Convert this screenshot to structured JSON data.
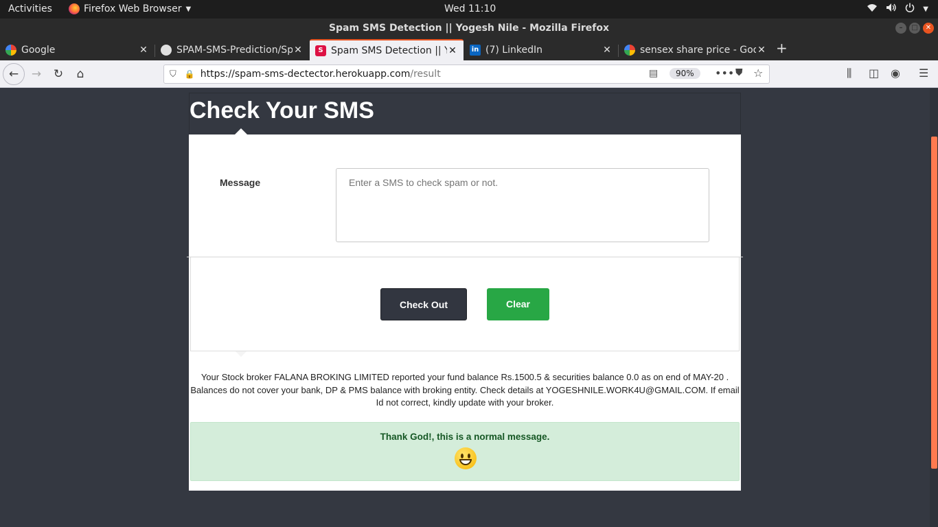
{
  "os": {
    "activities": "Activities",
    "app_menu": "Firefox Web Browser",
    "clock": "Wed 11:10"
  },
  "window": {
    "title": "Spam SMS Detection || Yogesh Nile - Mozilla Firefox"
  },
  "tabs": [
    {
      "label": "Google",
      "favicon": "google-icon"
    },
    {
      "label": "SPAM-SMS-Prediction/Sp",
      "favicon": "github-icon"
    },
    {
      "label": "Spam SMS Detection || Yo",
      "favicon": "spam-site-icon",
      "active": true
    },
    {
      "label": "(7) LinkedIn",
      "favicon": "linkedin-icon"
    },
    {
      "label": "sensex share price - Goo",
      "favicon": "google-icon"
    }
  ],
  "navbar": {
    "url_host": "https://spam-sms-dectector.herokuapp.com",
    "url_path": "/result",
    "zoom": "90%"
  },
  "page": {
    "heading": "Check Your SMS",
    "message_label": "Message",
    "message_placeholder": "Enter a SMS to check spam or not.",
    "check_button": "Check Out",
    "clear_button": "Clear",
    "sms_text": "Your Stock broker FALANA BROKING LIMITED reported your fund balance Rs.1500.5 & securities balance 0.0 as on end of MAY-20 . Balances do not cover your bank, DP & PMS balance with broking entity. Check details at YOGESHNILE.WORK4U@GMAIL.COM. If email Id not correct, kindly update with your broker.",
    "result_text": "Thank God!, this is a normal message.",
    "result_icon": "grinning-face-icon"
  },
  "colors": {
    "page_bg": "#343841",
    "check_button": "#323640",
    "clear_button": "#28a745",
    "alert_bg": "#d4edda",
    "alert_text": "#155724",
    "accent": "#e95420"
  }
}
